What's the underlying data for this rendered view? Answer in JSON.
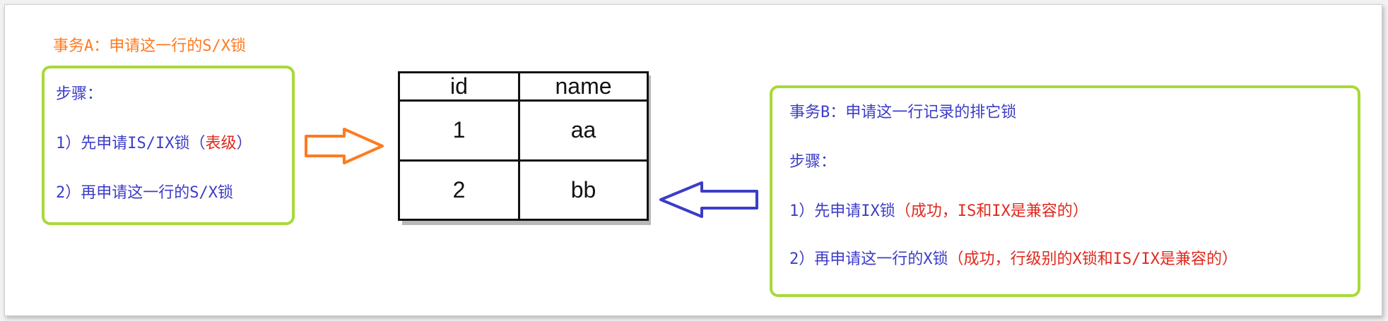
{
  "transaction_a": {
    "title": "事务A：申请这一行的S/X锁",
    "steps_heading": "步骤：",
    "step1_prefix": "1）先申请IS/IX锁（",
    "step1_note": "表级",
    "step1_suffix": "）",
    "step2": "2）再申请这一行的S/X锁"
  },
  "table": {
    "headers": [
      "id",
      "name"
    ],
    "rows": [
      [
        "1",
        "aa"
      ],
      [
        "2",
        "bb"
      ]
    ]
  },
  "transaction_b": {
    "title": "事务B：申请这一行记录的排它锁",
    "steps_heading": "步骤：",
    "step1_prefix": "1）先申请IX锁",
    "step1_note": "（成功，IS和IX是兼容的）",
    "step2_prefix": "2）再申请这一行的X锁",
    "step2_note": "（成功，行级别的X锁和IS/IX是兼容的）"
  },
  "colors": {
    "transaction_a_title": "#ff7a1f",
    "step_text": "#3c3cc8",
    "note_text": "#e0281e",
    "box_border": "#a8d93a",
    "arrow_a": "#ff7a1f",
    "arrow_b": "#3c3cc8"
  },
  "icons": {
    "arrow_a": "right-arrow-outline",
    "arrow_b": "left-arrow-outline"
  }
}
